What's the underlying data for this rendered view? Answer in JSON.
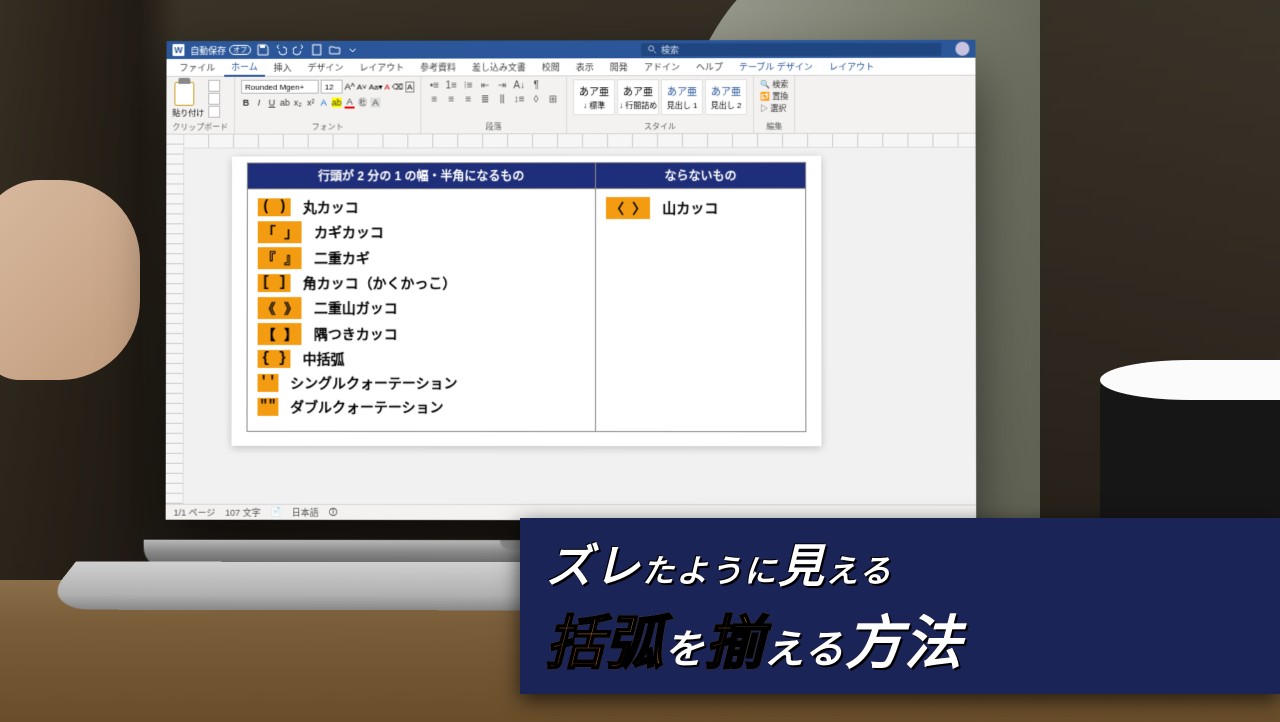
{
  "titlebar": {
    "autosave_label": "自動保存",
    "autosave_state": "オフ",
    "search_placeholder": "検索"
  },
  "ribbon": {
    "tabs": [
      "ファイル",
      "ホーム",
      "挿入",
      "デザイン",
      "レイアウト",
      "参考資料",
      "差し込み文書",
      "校閲",
      "表示",
      "開発",
      "アドイン",
      "ヘルプ"
    ],
    "extra_tabs": [
      "テーブル デザイン",
      "レイアウト"
    ],
    "active_tab_index": 1,
    "groups": {
      "clipboard": {
        "label": "クリップボード",
        "paste": "貼り付け"
      },
      "font": {
        "label": "フォント",
        "name": "Rounded Mgen+",
        "size": "12"
      },
      "paragraph": {
        "label": "段落"
      },
      "styles": {
        "label": "スタイル",
        "items": [
          {
            "sample": "あア亜",
            "name": "↓ 標準"
          },
          {
            "sample": "あア亜",
            "name": "↓ 行間詰め"
          },
          {
            "sample": "あア亜",
            "name": "見出し 1"
          },
          {
            "sample": "あア亜",
            "name": "見出し 2"
          }
        ]
      },
      "editing": {
        "label": "編集",
        "find": "検索",
        "replace": "置換",
        "select": "選択"
      }
    }
  },
  "document": {
    "table": {
      "header_left": "行頭が 2 分の 1 の幅・半角になるもの",
      "header_right": "ならないもの",
      "left_items": [
        {
          "symbol": "( )",
          "name": "丸カッコ"
        },
        {
          "symbol": "「 」",
          "name": "カギカッコ"
        },
        {
          "symbol": "『 』",
          "name": "二重カギ"
        },
        {
          "symbol": "[ ]",
          "name": "角カッコ（かくかっこ）"
        },
        {
          "symbol": "《 》",
          "name": "二重山ガッコ"
        },
        {
          "symbol": "【 】",
          "name": "隅つきカッコ"
        },
        {
          "symbol": "{ }",
          "name": "中括弧"
        },
        {
          "symbol": "''",
          "name": "シングルクォーテーション",
          "thin": true
        },
        {
          "symbol": "\"\"",
          "name": "ダブルクォーテーション",
          "thin": true
        }
      ],
      "right_items": [
        {
          "symbol": "〈 〉",
          "name": "山カッコ"
        }
      ]
    }
  },
  "statusbar": {
    "page": "1/1 ページ",
    "words": "107 文字",
    "proof_icon": "📄",
    "lang": "日本語",
    "acc_icon": "🛈"
  },
  "overlay": {
    "line1_a": "ズレ",
    "line1_b": "たように",
    "line1_c": "見",
    "line1_d": "える",
    "line2_a": "括弧",
    "line2_b": "を",
    "line2_c": "揃",
    "line2_d": "える",
    "line2_e": "方法"
  }
}
